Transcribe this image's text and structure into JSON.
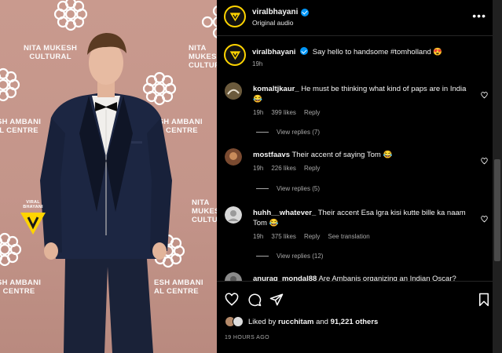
{
  "photo": {
    "watermark_lines": [
      "NITA MUKESH",
      "CULTURAL",
      "SH AMBANI",
      "L CENTRE",
      "NITA MUKESH",
      "CULTURAL",
      "NITA MUKES",
      "CULTURAL",
      "ESH AMBANI",
      "AL CENTRE",
      "SH AMBANI",
      "CENTRE"
    ],
    "logo_text": "VIRAL BHAYANI",
    "logo_color": "#ffd400"
  },
  "header": {
    "username": "viralbhayani",
    "audio": "Original audio",
    "more": "•••"
  },
  "caption": {
    "username": "viralbhayani",
    "text": "Say hello to handsome #tomholland 😍",
    "time": "19h"
  },
  "comments": [
    {
      "username": "komaltjkaur_",
      "text": "He must be thinking what kind of paps are in India 😂",
      "time": "19h",
      "likes": "399 likes",
      "reply": "Reply",
      "view_replies": "View replies (7)",
      "avatar_color": "#6b5a3c"
    },
    {
      "username": "mostfaavs",
      "text": "Their accent of saying Tom 😂",
      "time": "19h",
      "likes": "226 likes",
      "reply": "Reply",
      "view_replies": "View replies (5)",
      "avatar_color": "#7a4a30"
    },
    {
      "username": "huhh__whatever_",
      "text": "Their accent Esa lgra kisi kutte bille ka naam Tom 😂",
      "time": "19h",
      "likes": "375 likes",
      "reply": "Reply",
      "translation": "See translation",
      "view_replies": "View replies (12)",
      "avatar_color": "#d8d8d8"
    },
    {
      "username": "anurag_mondal88",
      "text": "Are Ambanis organizing an Indian Oscar?",
      "avatar_color": "#8a8a8a"
    }
  ],
  "footer": {
    "liked_by_prefix": "Liked by",
    "liked_by_user": "rucchitam",
    "liked_by_and": "and",
    "liked_by_count": "91,221 others",
    "timestamp": "19 HOURS AGO"
  },
  "colors": {
    "background": "#000000",
    "photo_backdrop": "#c4958a",
    "verified": "#0095f6",
    "secondary_text": "#a8a8a8",
    "heart_liked": "#ff3040"
  }
}
